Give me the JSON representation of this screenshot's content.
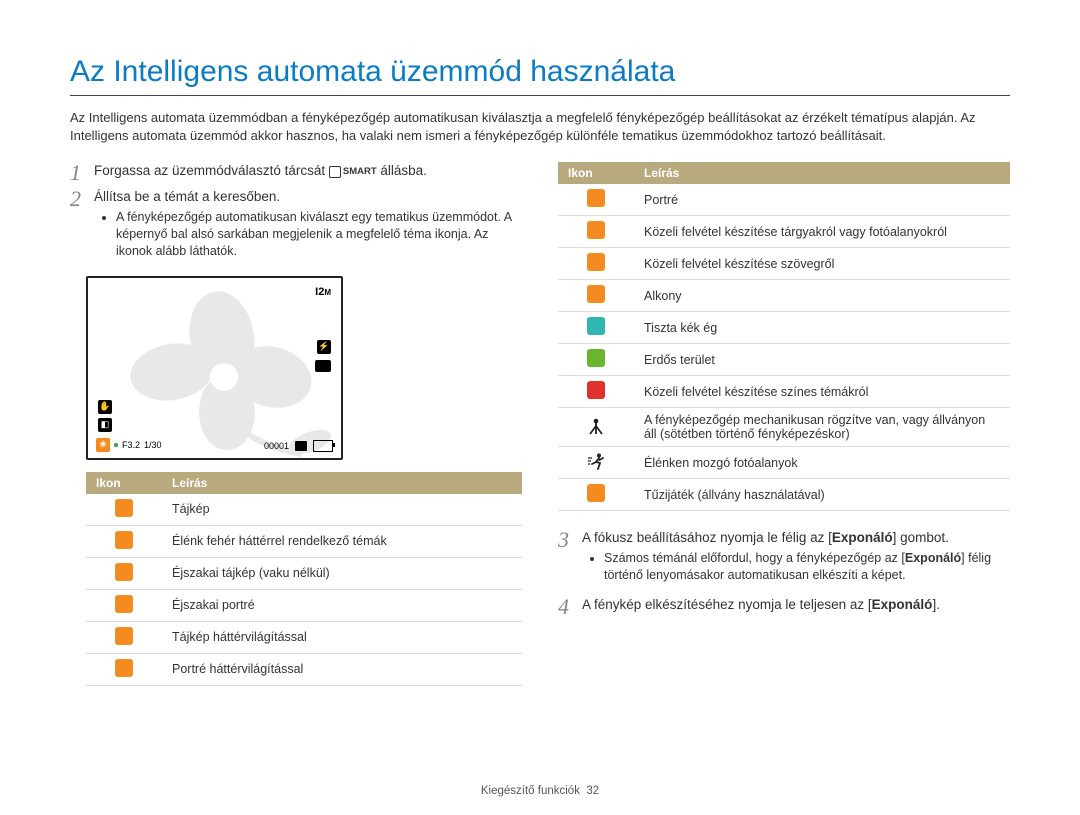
{
  "title": "Az Intelligens automata üzemmód használata",
  "intro": "Az Intelligens automata üzemmódban a fényképezőgép automatikusan kiválasztja a megfelelő fényképezőgép beállításokat az érzékelt tématípus alapján. Az Intelligens automata üzemmód akkor hasznos, ha valaki nem ismeri a fényképezőgép különféle tematikus üzemmódokhoz tartozó beállításait.",
  "steps": {
    "s1": {
      "num": "1",
      "pre": "Forgassa az üzemmódválasztó tárcsát ",
      "smart": "SMART",
      "post": " állásba."
    },
    "s2": {
      "num": "2",
      "text": "Állítsa be a témát a keresőben.",
      "bullet": "A fényképezőgép automatikusan kiválaszt egy tematikus üzemmódot. A képernyő bal alsó sarkában megjelenik a megfelelő téma ikonja. Az ikonok alább láthatók."
    },
    "s3": {
      "num": "3",
      "pre": "A fókusz beállításához nyomja le félig az [",
      "bold": "Exponáló",
      "post": "] gombot.",
      "bullet_pre": "Számos témánál előfordul, hogy a fényképezőgép az [",
      "bullet_bold": "Exponáló",
      "bullet_post": "] félig történő lenyomásakor automatikusan elkészíti a képet."
    },
    "s4": {
      "num": "4",
      "pre": "A fénykép elkészítéséhez nyomja le teljesen az [",
      "bold": "Exponáló",
      "post": "]."
    }
  },
  "camera": {
    "topright": "12m",
    "f": "F3.2",
    "shutter": "1/30",
    "counter": "00001"
  },
  "table_headers": {
    "ikon": "Ikon",
    "leiras": "Leírás"
  },
  "table_left": [
    {
      "icon": "orange",
      "label": "Tájkép"
    },
    {
      "icon": "orange",
      "label": "Élénk fehér háttérrel rendelkező témák"
    },
    {
      "icon": "orange",
      "label": "Éjszakai tájkép (vaku nélkül)"
    },
    {
      "icon": "orange",
      "label": "Éjszakai portré"
    },
    {
      "icon": "orange",
      "label": "Tájkép háttérvilágítással"
    },
    {
      "icon": "orange",
      "label": "Portré háttérvilágítással"
    }
  ],
  "table_right": [
    {
      "icon": "orange",
      "label": "Portré"
    },
    {
      "icon": "orange",
      "label": "Közeli felvétel készítése tárgyakról vagy fotóalanyokról"
    },
    {
      "icon": "orange",
      "label": "Közeli felvétel készítése szövegről"
    },
    {
      "icon": "orange",
      "label": "Alkony"
    },
    {
      "icon": "teal",
      "label": "Tiszta kék ég"
    },
    {
      "icon": "green",
      "label": "Erdős terület"
    },
    {
      "icon": "red",
      "label": "Közeli felvétel készítése színes témákról"
    },
    {
      "icon": "plain-tripod",
      "label": "A fényképezőgép mechanikusan rögzítve van, vagy állványon áll (sötétben történő fényképezéskor)"
    },
    {
      "icon": "plain-motion",
      "label": "Élénken mozgó fotóalanyok"
    },
    {
      "icon": "orange",
      "label": "Tűzijáték (állvány használatával)"
    }
  ],
  "footer": {
    "section": "Kiegészítő funkciók",
    "page": "32"
  }
}
